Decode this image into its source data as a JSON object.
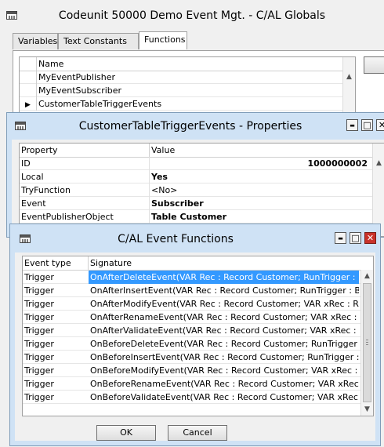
{
  "globals_window": {
    "title": "Codeunit 50000 Demo Event Mgt. - C/AL Globals",
    "tabs": [
      {
        "label": "Variables"
      },
      {
        "label": "Text Constants"
      },
      {
        "label": "Functions"
      }
    ],
    "column_name": "Name",
    "functions": [
      {
        "name": "MyEventPublisher"
      },
      {
        "name": "MyEventSubscriber"
      },
      {
        "name": "CustomerTableTriggerEvents",
        "current": "▶"
      }
    ]
  },
  "properties_window": {
    "title": "CustomerTableTriggerEvents - Properties",
    "column_property": "Property",
    "column_value": "Value",
    "rows": [
      {
        "property": "ID",
        "value": "1000000002"
      },
      {
        "property": "Local",
        "value": "Yes"
      },
      {
        "property": "TryFunction",
        "value": "<No>"
      },
      {
        "property": "Event",
        "value": "Subscriber"
      },
      {
        "property": "EventPublisherObject",
        "value": "Table Customer"
      }
    ]
  },
  "event_functions_window": {
    "title": "C/AL Event Functions",
    "column_event_type": "Event type",
    "column_signature": "Signature",
    "rows": [
      {
        "event_type": "Trigger",
        "signature": "OnAfterDeleteEvent(VAR Rec : Record Customer; RunTrigger : Bool..."
      },
      {
        "event_type": "Trigger",
        "signature": "OnAfterInsertEvent(VAR Rec : Record Customer; RunTrigger : Bool..."
      },
      {
        "event_type": "Trigger",
        "signature": "OnAfterModifyEvent(VAR Rec : Record Customer; VAR xRec : Reco..."
      },
      {
        "event_type": "Trigger",
        "signature": "OnAfterRenameEvent(VAR Rec : Record Customer; VAR xRec : Rec..."
      },
      {
        "event_type": "Trigger",
        "signature": "OnAfterValidateEvent(VAR Rec : Record Customer; VAR xRec : Rec..."
      },
      {
        "event_type": "Trigger",
        "signature": "OnBeforeDeleteEvent(VAR Rec : Record Customer; RunTrigger : Bo..."
      },
      {
        "event_type": "Trigger",
        "signature": "OnBeforeInsertEvent(VAR Rec : Record Customer; RunTrigger : Bo..."
      },
      {
        "event_type": "Trigger",
        "signature": "OnBeforeModifyEvent(VAR Rec : Record Customer; VAR xRec : Rec..."
      },
      {
        "event_type": "Trigger",
        "signature": "OnBeforeRenameEvent(VAR Rec : Record Customer; VAR xRec : R..."
      },
      {
        "event_type": "Trigger",
        "signature": "OnBeforeValidateEvent(VAR Rec : Record Customer; VAR xRec : R..."
      }
    ],
    "ok_label": "OK",
    "cancel_label": "Cancel"
  },
  "window_controls": {
    "minimize": "▬",
    "maximize": "□",
    "close": "✕"
  },
  "colors": {
    "selection": "#3399ff",
    "active_titlebar": "#cfe2f5",
    "close_button": "#c9322a"
  }
}
